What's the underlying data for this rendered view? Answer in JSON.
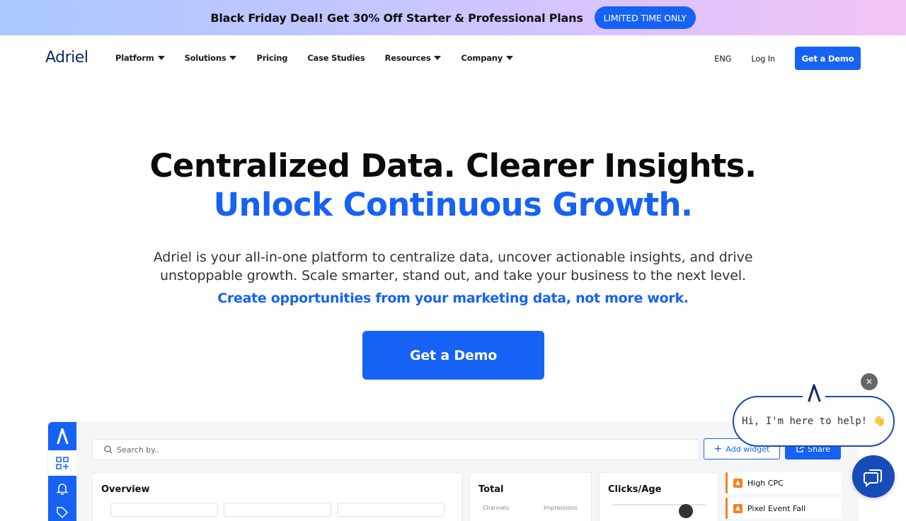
{
  "promo": {
    "text": "Black Friday Deal! Get 30% Off Starter & Professional Plans",
    "badge": "LIMITED TIME ONLY"
  },
  "nav": {
    "logo": "Adriel",
    "items": [
      {
        "label": "Platform",
        "has_dropdown": true
      },
      {
        "label": "Solutions",
        "has_dropdown": true
      },
      {
        "label": "Pricing",
        "has_dropdown": false
      },
      {
        "label": "Case Studies",
        "has_dropdown": false
      },
      {
        "label": "Resources",
        "has_dropdown": true
      },
      {
        "label": "Company",
        "has_dropdown": true
      }
    ],
    "language": "ENG",
    "login": "Log In",
    "demo": "Get a Demo"
  },
  "hero": {
    "title_line1": "Centralized Data. Clearer Insights.",
    "title_line2": "Unlock Continuous Growth.",
    "desc_line1": "Adriel is your all-in-one platform to centralize data, uncover actionable insights, and drive",
    "desc_line2": "unstoppable growth. Scale smarter, stand out, and take your business to the next level.",
    "tagline": "Create opportunities from your marketing data, not more work.",
    "cta": "Get a Demo"
  },
  "dashboard": {
    "search_placeholder": "Search by..",
    "add_widget": "Add widget",
    "share": "Share",
    "cards": {
      "overview": "Overview",
      "total": "Total",
      "total_labels": [
        "Channels",
        "Impressions"
      ],
      "clicks_age": "Clicks/Age"
    },
    "alerts": [
      "High CPC",
      "Pixel Event Fall"
    ]
  },
  "chat": {
    "message": "Hi, I'm here to help! 👋"
  },
  "colors": {
    "accent": "#1662f5",
    "chat_accent": "#174bb8",
    "alert": "#f5821f"
  }
}
